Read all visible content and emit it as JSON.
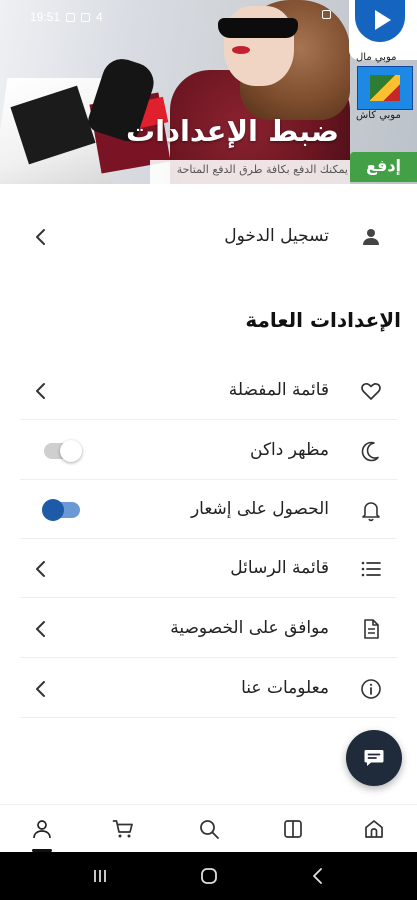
{
  "status_bar": {
    "time": "19:51",
    "signal_count": "4"
  },
  "banner": {
    "title": "ضبط الإعدادات",
    "subtitle": "يمكنك الدفع بكافة طرق الدفع المتاحة",
    "brand_name_top": "موبي مال",
    "brand_name_bottom": "موبي كاش",
    "pay_badge": "إدفع"
  },
  "login": {
    "label": "تسجيل الدخول",
    "icon": "user-icon"
  },
  "general_settings": {
    "heading": "الإعدادات العامة",
    "items": [
      {
        "label": "قائمة المفضلة",
        "icon": "heart-icon",
        "control": "chevron"
      },
      {
        "label": "مظهر داكن",
        "icon": "moon-icon",
        "control": "toggle",
        "on": false
      },
      {
        "label": "الحصول على إشعار",
        "icon": "bell-icon",
        "control": "toggle",
        "on": true
      },
      {
        "label": "قائمة الرسائل",
        "icon": "list-icon",
        "control": "chevron"
      },
      {
        "label": "موافق على الخصوصية",
        "icon": "document-icon",
        "control": "chevron"
      },
      {
        "label": "معلومات عنا",
        "icon": "info-icon",
        "control": "chevron"
      }
    ]
  },
  "fab": {
    "icon": "chat-icon"
  },
  "bottom_nav": [
    {
      "name": "profile",
      "icon": "profile-icon",
      "active": true
    },
    {
      "name": "cart",
      "icon": "cart-icon",
      "active": false
    },
    {
      "name": "search",
      "icon": "search-icon",
      "active": false
    },
    {
      "name": "categories",
      "icon": "book-icon",
      "active": false
    },
    {
      "name": "home",
      "icon": "home-icon",
      "active": false
    }
  ],
  "colors": {
    "toggle_on": "#1e5aa8",
    "fab": "#1f2a3a",
    "badge": "#43a047",
    "brand": "#1565c0"
  }
}
